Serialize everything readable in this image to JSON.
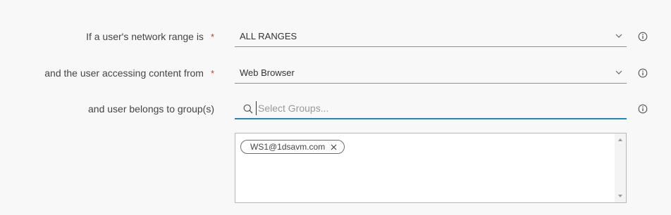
{
  "network_range": {
    "label": "If a user's network range is",
    "required_marker": "*",
    "value": "ALL RANGES",
    "chevron_icon": "chevron-down-icon",
    "info_icon": "info-icon"
  },
  "access_from": {
    "label": "and the user accessing content from",
    "required_marker": "*",
    "value": "Web Browser",
    "chevron_icon": "chevron-down-icon",
    "info_icon": "info-icon"
  },
  "groups": {
    "label": "and user belongs to group(s)",
    "placeholder": "Select Groups...",
    "search_icon": "search-icon",
    "info_icon": "info-icon",
    "selected": [
      {
        "label": "WS1@1dsavm.com",
        "remove_icon": "close-icon"
      }
    ]
  },
  "colors": {
    "required": "#c9401a",
    "focus_underline": "#1b8ab8",
    "background": "#f8f8f8"
  }
}
